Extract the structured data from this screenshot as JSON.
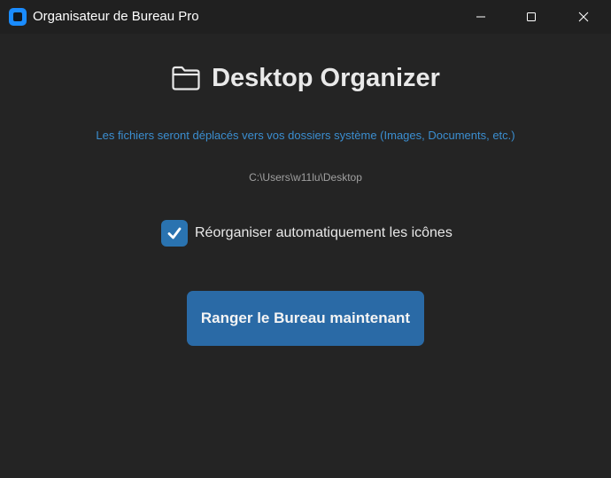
{
  "window": {
    "title": "Organisateur de Bureau Pro",
    "controls": {
      "minimize": "minimize-icon",
      "maximize": "maximize-icon",
      "close": "close-icon"
    }
  },
  "main": {
    "heading": "Desktop Organizer",
    "heading_icon": "folder-icon",
    "info": "Les fichiers seront déplacés vers vos dossiers système (Images, Documents, etc.)",
    "path": "C:\\Users\\w11lu\\Desktop",
    "auto_arrange": {
      "label": "Réorganiser automatiquement les icônes",
      "checked": true
    },
    "action_button": "Ranger le Bureau maintenant"
  },
  "colors": {
    "background": "#242424",
    "titlebar": "#202020",
    "accent": "#2a6aa6",
    "info_text": "#3b8ed0",
    "path_text": "#a0a0a0"
  }
}
